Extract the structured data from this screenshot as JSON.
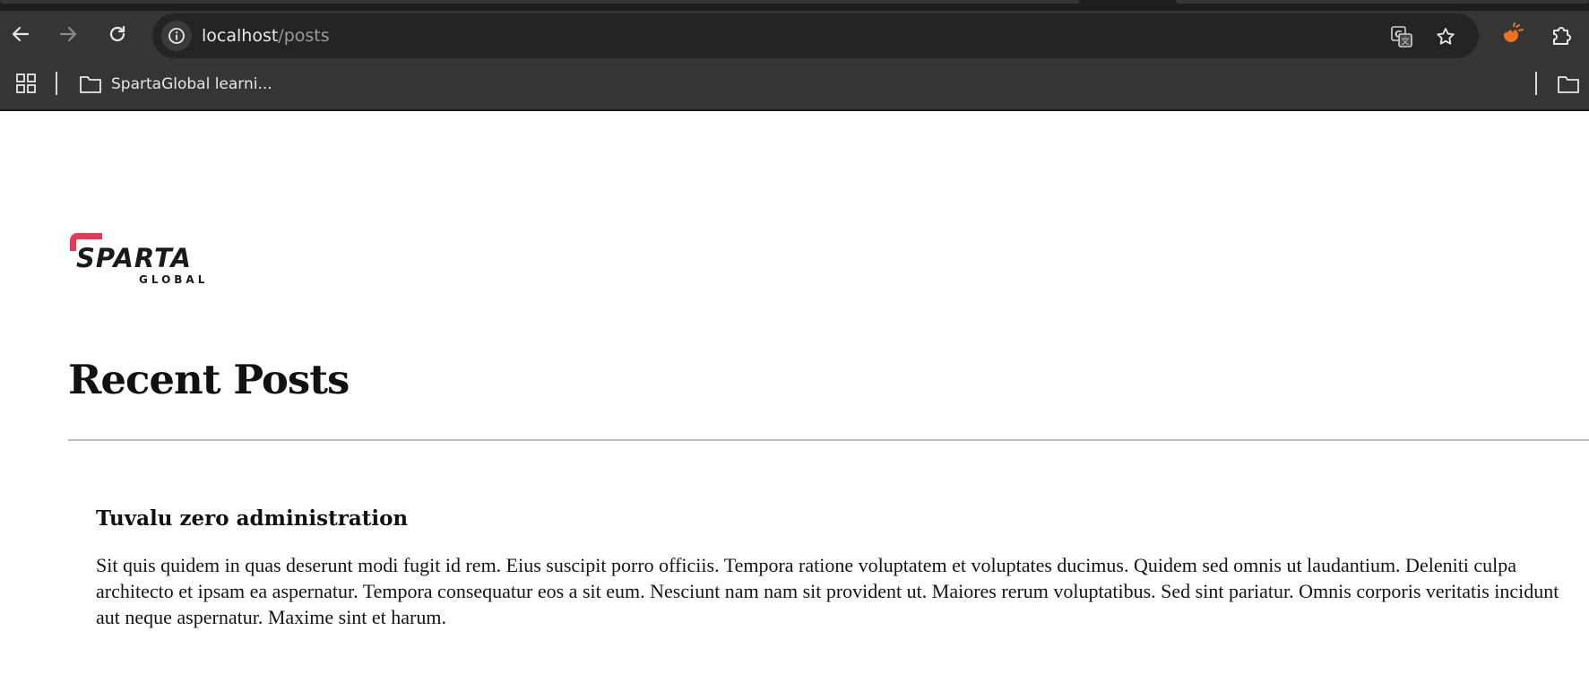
{
  "browser": {
    "address_bar": {
      "host": "localhost",
      "path": "/posts"
    },
    "bookmarks": {
      "items": [
        {
          "label": "SpartaGlobal learni..."
        }
      ]
    }
  },
  "logo": {
    "wordmark": "SPARTA",
    "sub": "GLOBAL",
    "accent_color": "#e5395a"
  },
  "main": {
    "title": "Recent Posts",
    "posts": [
      {
        "title": "Tuvalu zero administration",
        "body": "Sit quis quidem in quas deserunt modi fugit id rem. Eius suscipit porro officiis. Tempora ratione voluptatem et voluptates ducimus. Quidem sed omnis ut laudantium. Deleniti culpa architecto et ipsam ea aspernatur. Tempora consequatur eos a sit eum. Nesciunt nam nam sit provident ut. Maiores rerum voluptatibus. Sed sint pariatur. Omnis corporis veritatis incidunt aut neque aspernatur. Maxime sint et harum."
      }
    ]
  },
  "icons": {
    "back": "arrow-left-icon",
    "forward": "arrow-right-icon",
    "reload": "reload-icon",
    "site_info": "info-icon",
    "translate": "translate-icon",
    "bookmark_star": "star-icon",
    "extension_orange": "extension-icon",
    "extensions_puzzle": "puzzle-icon",
    "apps": "apps-grid-icon",
    "folder": "folder-icon"
  }
}
